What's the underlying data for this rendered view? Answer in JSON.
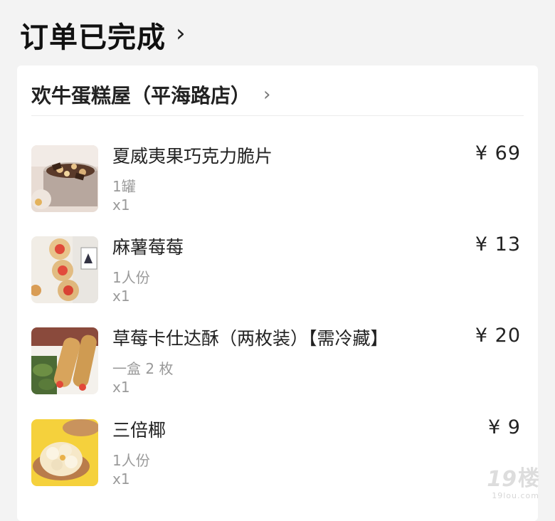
{
  "header": {
    "title": "订单已完成",
    "chevron": "›"
  },
  "shop": {
    "name": "欢牛蛋糕屋（平海路店）",
    "chevron": "›"
  },
  "items": [
    {
      "title": "夏威夷果巧克力脆片",
      "spec": "1罐",
      "qty": "x1",
      "price": "¥ 69",
      "image": "chocolate-chips-thumbnail"
    },
    {
      "title": "麻薯莓莓",
      "spec": "1人份",
      "qty": "x1",
      "price": "¥ 13",
      "image": "mochi-strawberry-thumbnail"
    },
    {
      "title": "草莓卡仕达酥（两枚装）【需冷藏】",
      "spec": "一盒 2 枚",
      "qty": "x1",
      "price": "¥ 20",
      "image": "strawberry-custard-pastry-thumbnail"
    },
    {
      "title": "三倍椰",
      "spec": "1人份",
      "qty": "x1",
      "price": "¥ 9",
      "image": "triple-coconut-thumbnail"
    }
  ],
  "watermark": {
    "number": "19",
    "char": "楼",
    "url": "19lou.com"
  },
  "colors": {
    "background": "#f3f3f3",
    "card": "#ffffff",
    "muted_text": "#9a9a9a"
  }
}
